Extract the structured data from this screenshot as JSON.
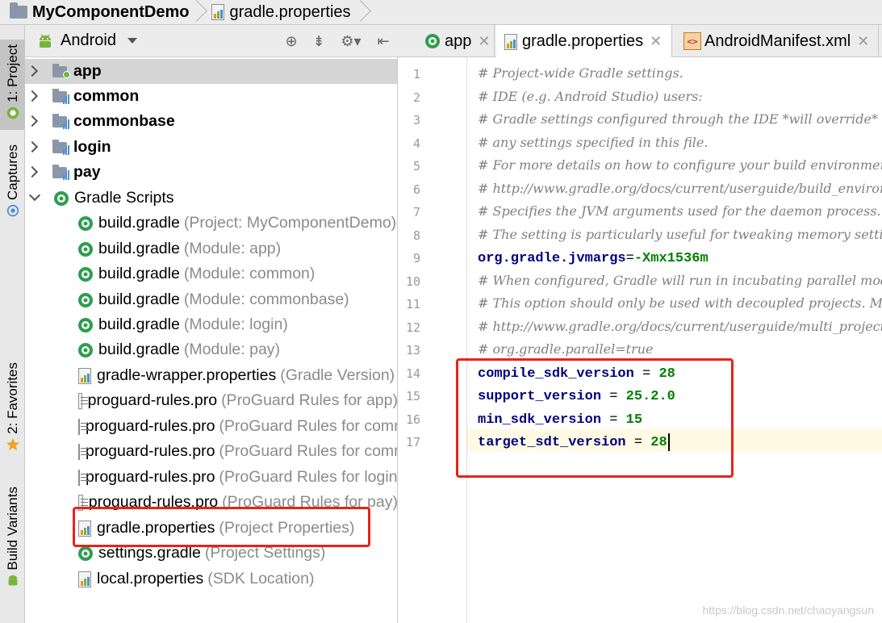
{
  "breadcrumb": {
    "project": "MyComponentDemo",
    "file": "gradle.properties"
  },
  "left_stripe": {
    "project_tab": "1: Project",
    "captures_tab": "Captures",
    "favorites_tab": "2: Favorites",
    "build_variants_tab": "Build Variants"
  },
  "project_panel": {
    "view_mode": "Android",
    "modules": [
      {
        "name": "app"
      },
      {
        "name": "common"
      },
      {
        "name": "commonbase"
      },
      {
        "name": "login"
      },
      {
        "name": "pay"
      }
    ],
    "gradle_scripts_label": "Gradle Scripts",
    "scripts": [
      {
        "name": "build.gradle",
        "hint": "(Project: MyComponentDemo)",
        "icon": "gradle-icon"
      },
      {
        "name": "build.gradle",
        "hint": "(Module: app)",
        "icon": "gradle-icon"
      },
      {
        "name": "build.gradle",
        "hint": "(Module: common)",
        "icon": "gradle-icon"
      },
      {
        "name": "build.gradle",
        "hint": "(Module: commonbase)",
        "icon": "gradle-icon"
      },
      {
        "name": "build.gradle",
        "hint": "(Module: login)",
        "icon": "gradle-icon"
      },
      {
        "name": "build.gradle",
        "hint": "(Module: pay)",
        "icon": "gradle-icon"
      },
      {
        "name": "gradle-wrapper.properties",
        "hint": "(Gradle Version)",
        "icon": "properties-icon"
      },
      {
        "name": "proguard-rules.pro",
        "hint": "(ProGuard Rules for app)",
        "icon": "text-file-icon"
      },
      {
        "name": "proguard-rules.pro",
        "hint": "(ProGuard Rules for common)",
        "icon": "text-file-icon"
      },
      {
        "name": "proguard-rules.pro",
        "hint": "(ProGuard Rules for commonbase)",
        "icon": "text-file-icon"
      },
      {
        "name": "proguard-rules.pro",
        "hint": "(ProGuard Rules for login)",
        "icon": "text-file-icon"
      },
      {
        "name": "proguard-rules.pro",
        "hint": "(ProGuard Rules for pay)",
        "icon": "text-file-icon"
      },
      {
        "name": "gradle.properties",
        "hint": "(Project Properties)",
        "icon": "properties-icon"
      },
      {
        "name": "settings.gradle",
        "hint": "(Project Settings)",
        "icon": "gradle-icon"
      },
      {
        "name": "local.properties",
        "hint": "(SDK Location)",
        "icon": "properties-icon"
      }
    ]
  },
  "tabs": [
    {
      "label": "app",
      "active": false
    },
    {
      "label": "gradle.properties",
      "active": true
    },
    {
      "label": "AndroidManifest.xml",
      "active": false
    }
  ],
  "editor": {
    "lines": [
      {
        "no": "1",
        "comment": "# Project-wide Gradle settings."
      },
      {
        "no": "2",
        "comment": "# IDE (e.g. Android Studio) users:"
      },
      {
        "no": "3",
        "comment": "# Gradle settings configured through the IDE *will override*"
      },
      {
        "no": "4",
        "comment": "# any settings specified in this file."
      },
      {
        "no": "5",
        "comment": "# For more details on how to configure your build environment visit"
      },
      {
        "no": "6",
        "comment": "# http://www.gradle.org/docs/current/userguide/build_environment.html"
      },
      {
        "no": "7",
        "comment": "# Specifies the JVM arguments used for the daemon process."
      },
      {
        "no": "8",
        "comment": "# The setting is particularly useful for tweaking memory settings."
      },
      {
        "no": "9",
        "key": "org.gradle.jvmargs",
        "eq": "=",
        "value": "-Xmx1536m"
      },
      {
        "no": "10",
        "comment": "# When configured, Gradle will run in incubating parallel mode."
      },
      {
        "no": "11",
        "comment": "# This option should only be used with decoupled projects. More details, visit"
      },
      {
        "no": "12",
        "comment": "# http://www.gradle.org/docs/current/userguide/multi_project_builds.html#sec:decoupled_projects"
      },
      {
        "no": "13",
        "comment": "# org.gradle.parallel=true"
      },
      {
        "no": "14",
        "key": "compile_sdk_version",
        "eq": " = ",
        "value": "28"
      },
      {
        "no": "15",
        "key": "support_version",
        "eq": " = ",
        "value": "25.2.0"
      },
      {
        "no": "16",
        "key": "min_sdk_version",
        "eq": " = ",
        "value": "15"
      },
      {
        "no": "17",
        "key": "target_sdt_version",
        "eq": " = ",
        "value": "28"
      }
    ]
  },
  "watermark": "https://blog.csdn.net/chaoyangsun",
  "colors": {
    "highlight": "#e8231b",
    "comment": "#808080",
    "key": "#000080",
    "value": "#008000",
    "android_green": "#7ab33b"
  }
}
